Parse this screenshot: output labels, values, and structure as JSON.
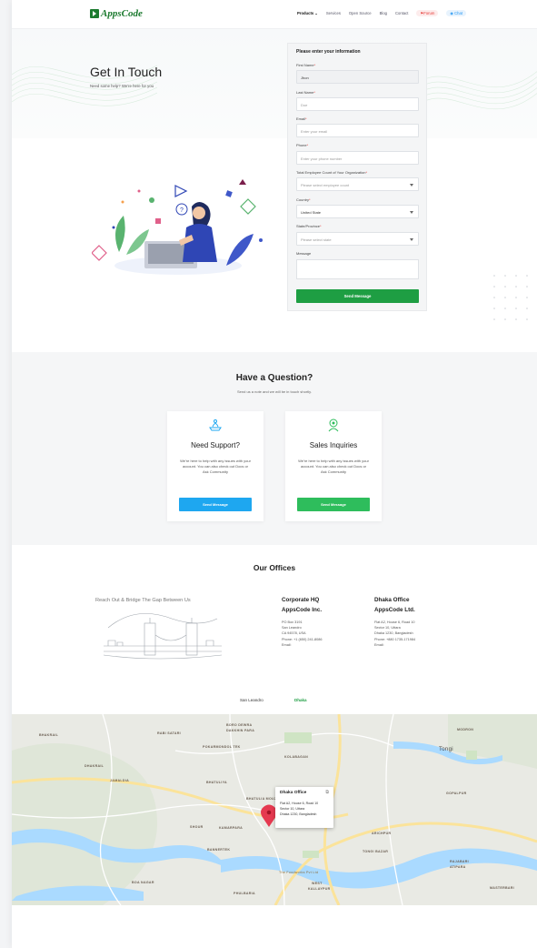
{
  "header": {
    "logo": "AppsCode",
    "nav": [
      "Products",
      "Services",
      "Open Source",
      "Blog",
      "Contact"
    ],
    "forum": "Forum",
    "chat": "Chat"
  },
  "hero": {
    "title": "Get In Touch",
    "subtitle": "Need some help? We're here for you"
  },
  "form": {
    "heading": "Please enter your information",
    "first_name_label": "First Name",
    "first_name_value": "Jhon",
    "last_name_label": "Last Name",
    "last_name_placeholder": "Doe",
    "email_label": "Email",
    "email_placeholder": "Enter your email",
    "phone_label": "Phone",
    "phone_placeholder": "Enter your phone number",
    "employee_label": "Total Employee Count of Your Organization",
    "employee_placeholder": "Please select employee count",
    "country_label": "Country",
    "country_value": "United State",
    "state_label": "State/Province",
    "state_placeholder": "Please select state",
    "message_label": "Message",
    "submit": "Send Message",
    "required_mark": "*"
  },
  "question": {
    "title": "Have a Question?",
    "subtitle": "Send us a note and we will be in touch shortly.",
    "cards": [
      {
        "title": "Need Support?",
        "text": "We're here to help with any issues with your account. You can also check out Docs or Ask Community",
        "button": "Send Message",
        "color": "#1ea7f0"
      },
      {
        "title": "Sales Inquiries",
        "text": "We're here to help with any issues with your account. You can also check out Docs or Ask Community",
        "button": "Send Message",
        "color": "#2ebd5c"
      }
    ]
  },
  "offices": {
    "title": "Our Offices",
    "tagline": "Reach Out & Bridge The Gap Between Us",
    "corporate": {
      "heading1": "Corporate HQ",
      "heading2": "AppsCode Inc.",
      "lines": [
        "PO Box 3191",
        "San Leandro",
        "CA 94578, USA",
        "Phone: +1 (650) 241-8086",
        "Email:"
      ]
    },
    "dhaka": {
      "heading1": "Dhaka Office",
      "heading2": "AppsCode Ltd.",
      "lines": [
        "Flat A2, House 6, Road 10",
        "Sector 10, Uttara",
        "Dhaka 1230, Bangladesh",
        "Phone: +880 1735-171984",
        "Email:"
      ]
    },
    "tabs": [
      "San Leandro",
      "Dhaka"
    ]
  },
  "map": {
    "popup_title": "Dhaka Office",
    "popup_lines": [
      "Flat A2, House 6, Road 10",
      "Sector 10, Uttara",
      "Dhaka 1230, Bangladesh"
    ],
    "labels": [
      "BHAKRAIL",
      "RABI SATARI",
      "BORO DEWRA",
      "DAKKHIN PARA",
      "DHAKRAIL",
      "POKARMONDOL TEK",
      "KOLABAGAN",
      "Tongi",
      "MODRON",
      "GOPALPUR",
      "JAMALDIA",
      "BHATULIYA",
      "BHATULIA MOUZA",
      "SHOUR",
      "KAMARPARA",
      "BANNERTEK",
      "ARICHPUR",
      "TONGI BAZAR",
      "BOA NAGAR",
      "PHULBARIA",
      "WEST",
      "KALLAYPUR",
      "RAJABARI",
      "ATIPARA",
      "MASTERBARI",
      "The Foodworks Pvt Ltd"
    ]
  }
}
